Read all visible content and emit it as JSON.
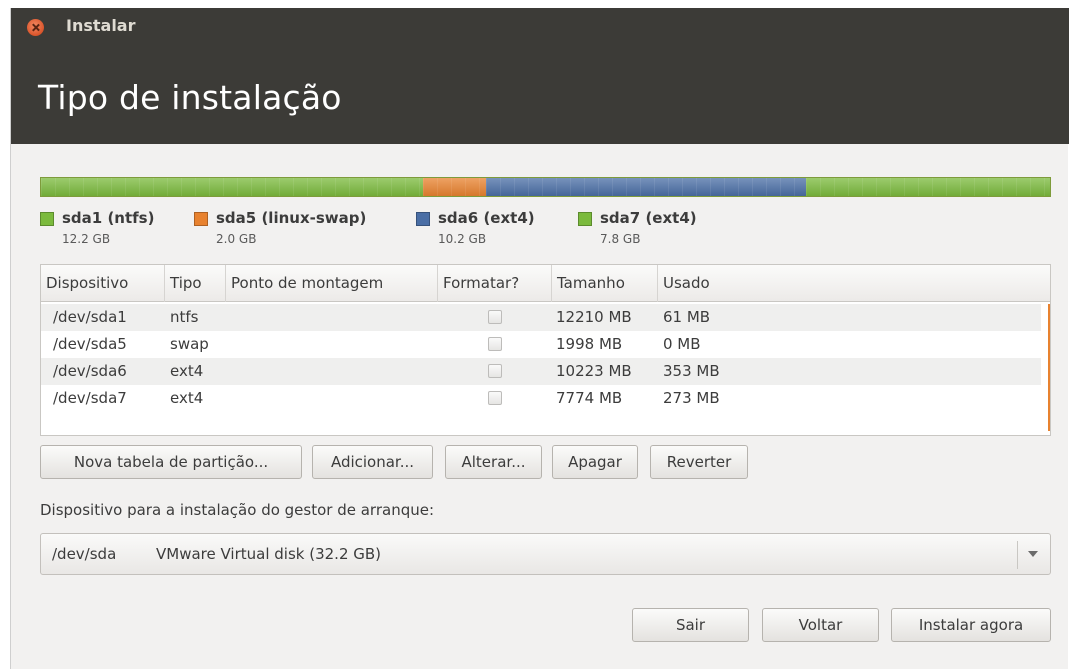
{
  "window": {
    "title": "Instalar"
  },
  "page": {
    "title": "Tipo de instalação"
  },
  "partitions": [
    {
      "name": "sda1 (ntfs)",
      "size": "12.2 GB",
      "color": "#7bba3d",
      "size_gb": 12.2
    },
    {
      "name": "sda5 (linux-swap)",
      "size": "2.0 GB",
      "color": "#e8822f",
      "size_gb": 2.0
    },
    {
      "name": "sda6 (ext4)",
      "size": "10.2 GB",
      "color": "#4a6ea5",
      "size_gb": 10.2
    },
    {
      "name": "sda7 (ext4)",
      "size": "7.8 GB",
      "color": "#7bba3d",
      "size_gb": 7.8
    }
  ],
  "table": {
    "headers": [
      "Dispositivo",
      "Tipo",
      "Ponto de montagem",
      "Formatar?",
      "Tamanho",
      "Usado"
    ],
    "rows": [
      {
        "device": "/dev/sda1",
        "type": "ntfs",
        "mount": "",
        "format": false,
        "size": "12210 MB",
        "used": "61 MB"
      },
      {
        "device": "/dev/sda5",
        "type": "swap",
        "mount": "",
        "format": false,
        "size": "1998 MB",
        "used": "0 MB"
      },
      {
        "device": "/dev/sda6",
        "type": "ext4",
        "mount": "",
        "format": false,
        "size": "10223 MB",
        "used": "353 MB"
      },
      {
        "device": "/dev/sda7",
        "type": "ext4",
        "mount": "",
        "format": false,
        "size": "7774 MB",
        "used": "273 MB"
      }
    ]
  },
  "actions": {
    "new_table": "Nova tabela de partição...",
    "add": "Adicionar...",
    "change": "Alterar...",
    "delete": "Apagar",
    "revert": "Reverter"
  },
  "bootloader": {
    "label": "Dispositivo para a instalação do gestor de arranque:",
    "device": "/dev/sda",
    "description": "VMware Virtual disk (32.2 GB)"
  },
  "footer": {
    "quit": "Sair",
    "back": "Voltar",
    "install": "Instalar agora"
  }
}
